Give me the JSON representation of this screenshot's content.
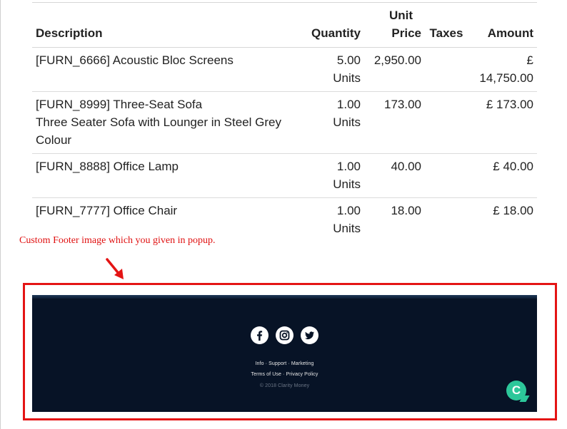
{
  "table": {
    "headers": {
      "description": "Description",
      "quantity": "Quantity",
      "unit_price_line1": "Unit",
      "unit_price_line2": "Price",
      "taxes": "Taxes",
      "amount": "Amount"
    },
    "rows": [
      {
        "description_line1": "[FURN_6666] Acoustic Bloc Screens",
        "description_line2": "",
        "quantity": "5.00",
        "unit": "Units",
        "unit_price": "2,950.00",
        "taxes": "",
        "amount": "£ 14,750.00"
      },
      {
        "description_line1": "[FURN_8999] Three-Seat Sofa",
        "description_line2": "Three Seater Sofa with Lounger in Steel Grey Colour",
        "quantity": "1.00",
        "unit": "Units",
        "unit_price": "173.00",
        "taxes": "",
        "amount": "£ 173.00"
      },
      {
        "description_line1": "[FURN_8888] Office Lamp",
        "description_line2": "",
        "quantity": "1.00",
        "unit": "Units",
        "unit_price": "40.00",
        "taxes": "",
        "amount": "£ 40.00"
      },
      {
        "description_line1": "[FURN_7777] Office Chair",
        "description_line2": "",
        "quantity": "1.00",
        "unit": "Units",
        "unit_price": "18.00",
        "taxes": "",
        "amount": "£ 18.00"
      }
    ]
  },
  "annotation": {
    "note": "Custom Footer image which you given in popup.",
    "color": "#e01010"
  },
  "footer_image": {
    "social_icons": [
      "facebook-icon",
      "instagram-icon",
      "twitter-icon"
    ],
    "links_line1": "Info · Support · Marketing",
    "links_line2": "Terms of Use · Privacy Policy",
    "copyright": "© 2018 Clarity Money",
    "chat_letter": "C",
    "background": "#071326",
    "chat_color": "#2cc79a"
  },
  "colors": {
    "frame": "#e41414"
  }
}
